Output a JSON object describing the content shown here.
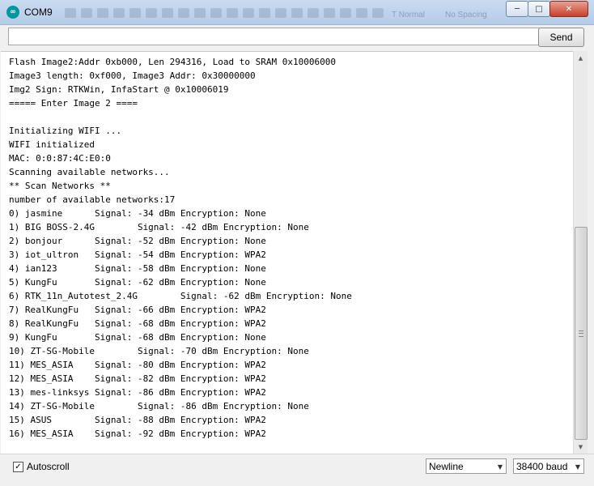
{
  "window": {
    "title": "COM9",
    "logo_text": "∞",
    "ghost_labels": [
      "T Normal",
      "No Spacing"
    ]
  },
  "input_bar": {
    "value": "",
    "placeholder": "",
    "send_label": "Send"
  },
  "output": {
    "lines": [
      "Flash Image2:Addr 0xb000, Len 294316, Load to SRAM 0x10006000",
      "Image3 length: 0xf000, Image3 Addr: 0x30000000",
      "Img2 Sign: RTKWin, InfaStart @ 0x10006019",
      "===== Enter Image 2 ====",
      "",
      "Initializing WIFI ...",
      "WIFI initialized",
      "MAC: 0:0:87:4C:E0:0",
      "Scanning available networks...",
      "** Scan Networks **",
      "number of available networks:17",
      "0) jasmine      Signal: -34 dBm Encryption: None",
      "1) BIG BOSS-2.4G        Signal: -42 dBm Encryption: None",
      "2) bonjour      Signal: -52 dBm Encryption: None",
      "3) iot_ultron   Signal: -54 dBm Encryption: WPA2",
      "4) ian123       Signal: -58 dBm Encryption: None",
      "5) KungFu       Signal: -62 dBm Encryption: None",
      "6) RTK_11n_Autotest_2.4G        Signal: -62 dBm Encryption: None",
      "7) RealKungFu   Signal: -66 dBm Encryption: WPA2",
      "8) RealKungFu   Signal: -68 dBm Encryption: WPA2",
      "9) KungFu       Signal: -68 dBm Encryption: None",
      "10) ZT-SG-Mobile        Signal: -70 dBm Encryption: None",
      "11) MES_ASIA    Signal: -80 dBm Encryption: WPA2",
      "12) MES_ASIA    Signal: -82 dBm Encryption: WPA2",
      "13) mes-linksys Signal: -86 dBm Encryption: WPA2",
      "14) ZT-SG-Mobile        Signal: -86 dBm Encryption: None",
      "15) ASUS        Signal: -88 dBm Encryption: WPA2",
      "16) MES_ASIA    Signal: -92 dBm Encryption: WPA2"
    ]
  },
  "statusbar": {
    "autoscroll_label": "Autoscroll",
    "autoscroll_checked": true,
    "check_glyph": "✓",
    "line_ending": "Newline",
    "baud_rate": "38400 baud"
  },
  "icons": {
    "minimize": "─",
    "maximize": "□",
    "close": "✕",
    "scroll_up": "▲",
    "scroll_down": "▼",
    "dropdown": "▼"
  }
}
